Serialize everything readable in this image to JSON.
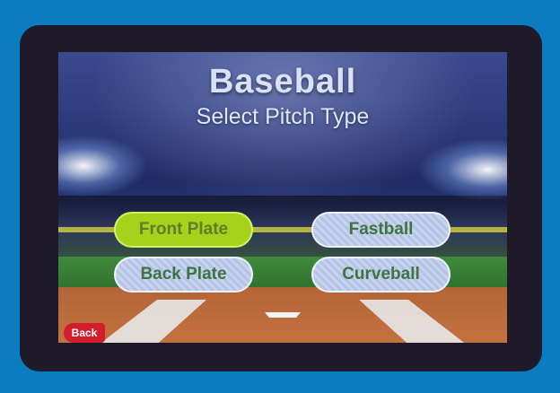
{
  "screen": {
    "title": "Baseball",
    "subtitle": "Select Pitch Type"
  },
  "buttons": {
    "front_plate": "Front Plate",
    "back_plate": "Back Plate",
    "fastball": "Fastball",
    "curveball": "Curveball",
    "back": "Back"
  },
  "state": {
    "selected": "front_plate"
  },
  "colors": {
    "background": "#0b7cbf",
    "frame": "#1e1a2a",
    "selected_button": "#a6d21c",
    "button": "#c7d3ec",
    "button_text": "#3f7442",
    "back_button": "#d21e2c"
  }
}
